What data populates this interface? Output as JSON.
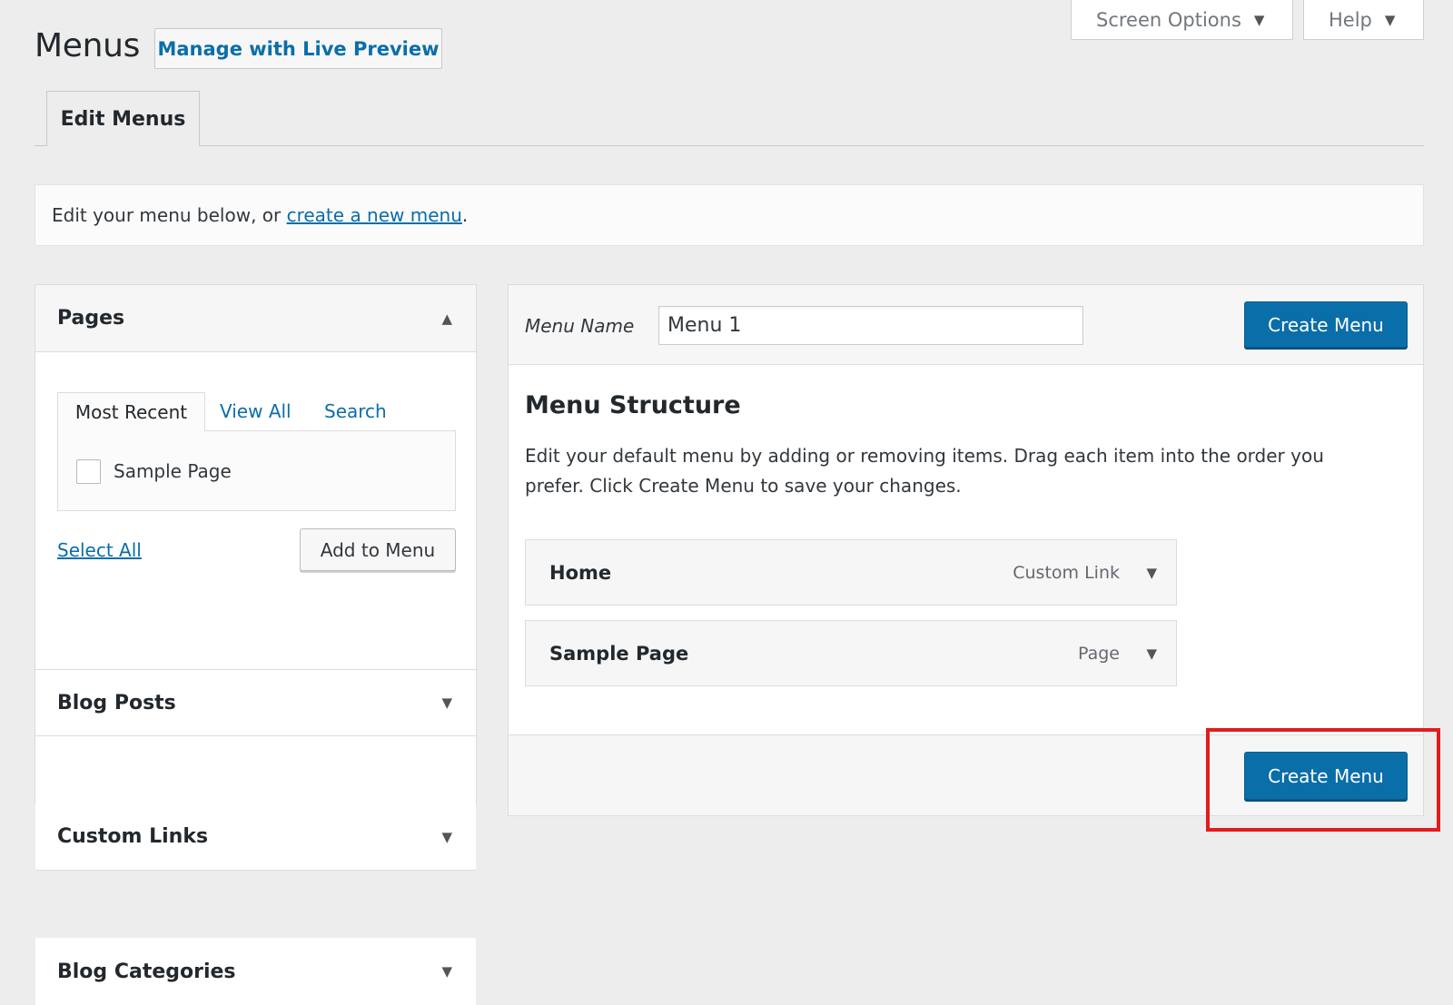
{
  "screen_meta": {
    "screen_options": "Screen Options",
    "help": "Help",
    "caret": "▼"
  },
  "header": {
    "title": "Menus",
    "live_preview": "Manage with Live Preview"
  },
  "tabs": {
    "edit_menus": "Edit Menus"
  },
  "notice": {
    "prefix": "Edit your menu below, or ",
    "link": "create a new menu",
    "suffix": "."
  },
  "sidebar": {
    "pages": {
      "title": "Pages",
      "arrow": "▲",
      "tabs": [
        "Most Recent",
        "View All",
        "Search"
      ],
      "items": [
        {
          "label": "Sample Page",
          "checked": false
        }
      ],
      "select_all": "Select All",
      "add_to_menu": "Add to Menu"
    },
    "sections": [
      {
        "title": "Blog Posts",
        "arrow": "▼"
      },
      {
        "title": "Custom Links",
        "arrow": "▼"
      },
      {
        "title": "Blog Categories",
        "arrow": "▼"
      }
    ]
  },
  "menu_edit": {
    "name_label": "Menu Name",
    "name_value": "Menu 1",
    "create_button": "Create Menu",
    "structure_title": "Menu Structure",
    "structure_desc": "Edit your default menu by adding or removing items. Drag each item into the order you prefer. Click Create Menu to save your changes.",
    "items": [
      {
        "title": "Home",
        "type": "Custom Link",
        "toggle": "▼"
      },
      {
        "title": "Sample Page",
        "type": "Page",
        "toggle": "▼"
      }
    ],
    "footer_create_button": "Create Menu"
  },
  "colors": {
    "primary": "#0a6ea9",
    "highlight": "#e21c1c",
    "background": "#ededed"
  }
}
